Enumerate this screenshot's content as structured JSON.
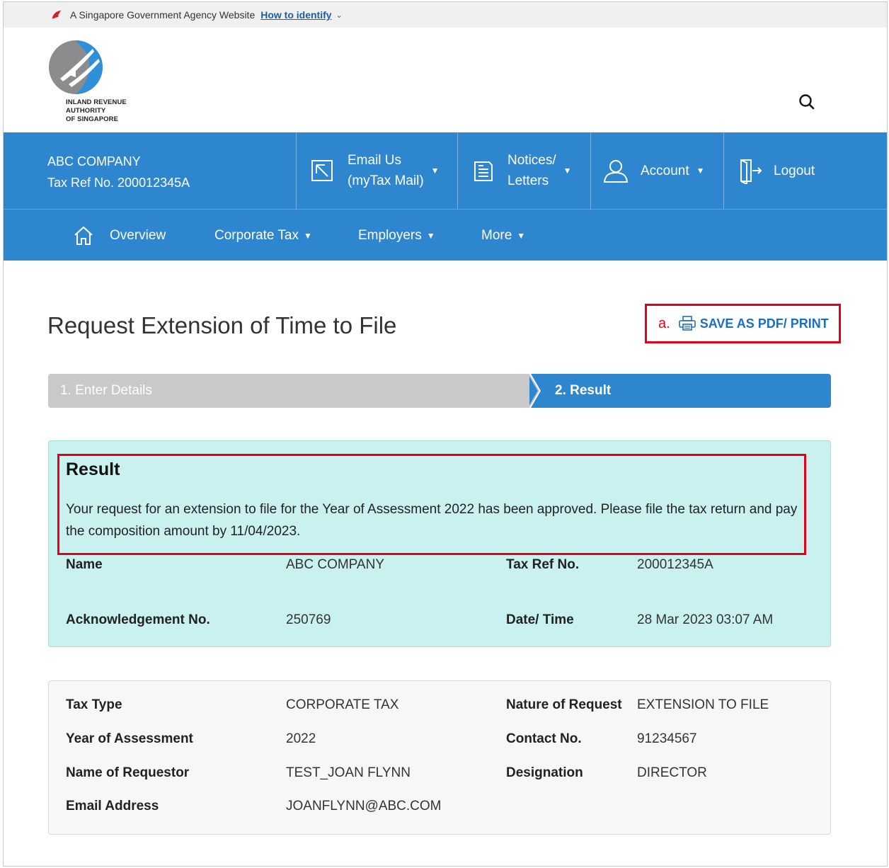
{
  "masthead": {
    "agency_text": "A Singapore Government Agency Website",
    "how_to_identify": "How to identify"
  },
  "logo": {
    "line1": "INLAND REVENUE",
    "line2": "AUTHORITY",
    "line3": "OF SINGAPORE"
  },
  "topbar": {
    "company_name": "ABC COMPANY",
    "tax_ref": "Tax Ref No. 200012345A",
    "email_line1": "Email Us",
    "email_line2": "(myTax Mail)",
    "notices_line1": "Notices/",
    "notices_line2": "Letters",
    "account": "Account",
    "logout": "Logout"
  },
  "nav": {
    "overview": "Overview",
    "corporate_tax": "Corporate Tax",
    "employers": "Employers",
    "more": "More"
  },
  "page": {
    "title": "Request Extension of Time to File",
    "annotation_label": "a.",
    "save_print": "SAVE AS PDF/ PRINT"
  },
  "stepper": {
    "step1": "1.  Enter Details",
    "step2": "2.  Result"
  },
  "result": {
    "heading": "Result",
    "message": "Your request for an extension to file for the Year of Assessment 2022 has been approved. Please file the tax return and pay the composition amount by 11/04/2023.",
    "name_label": "Name",
    "name_value": "ABC COMPANY",
    "taxref_label": "Tax Ref No.",
    "taxref_value": "200012345A",
    "ack_label": "Acknowledgement No.",
    "ack_value": "250769",
    "datetime_label": "Date/ Time",
    "datetime_value": "28 Mar 2023 03:07 AM"
  },
  "details": {
    "tax_type_label": "Tax Type",
    "tax_type_value": "CORPORATE TAX",
    "nature_label": "Nature of Request",
    "nature_value": "EXTENSION TO FILE",
    "ya_label": "Year of Assessment",
    "ya_value": "2022",
    "contact_label": "Contact No.",
    "contact_value": "91234567",
    "requestor_label": "Name of Requestor",
    "requestor_value": "TEST_JOAN FLYNN",
    "designation_label": "Designation",
    "designation_value": "DIRECTOR",
    "email_label": "Email Address",
    "email_value": "JOANFLYNN@ABC.COM"
  },
  "colors": {
    "brand_blue": "#2e86cf",
    "annotation_red": "#e3001b",
    "result_bg": "#c9f1ef",
    "link_blue": "#1a6fc0"
  },
  "icons": [
    "lion-head-icon",
    "chevron-down-icon",
    "iras-logo",
    "search-icon",
    "email-icon",
    "notices-icon",
    "user-icon",
    "logout-icon",
    "home-icon",
    "printer-icon"
  ]
}
